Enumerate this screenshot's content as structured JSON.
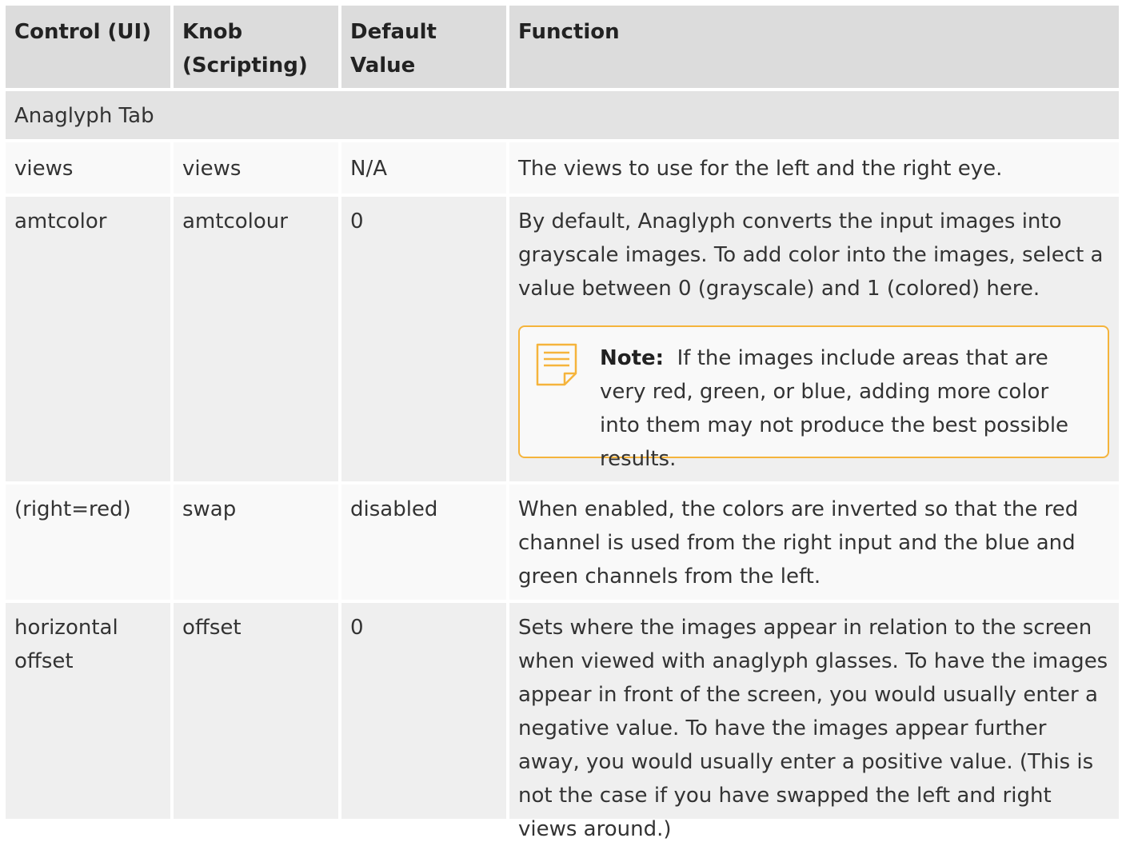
{
  "headers": {
    "control": "Control (UI)",
    "knob": "Knob (Scripting)",
    "default": "Default Value",
    "function": "Function"
  },
  "section_title": "Anaglyph Tab",
  "rows": [
    {
      "control": "views",
      "knob": "views",
      "default": "N/A",
      "function": "The views to use for the left and the right eye."
    },
    {
      "control": "amtcolor",
      "knob": "amtcolour",
      "default": "0",
      "function": "By default, Anaglyph converts the input images into grayscale images. To add color into the images, select a value between 0 (grayscale) and 1 (colored) here.",
      "note_label": "Note:",
      "note_text": "If the images include areas that are very red, green, or blue, adding more color into them may not produce the best possible results."
    },
    {
      "control": "(right=red)",
      "knob": "swap",
      "default": "disabled",
      "function": "When enabled, the colors are inverted so that the red channel is used from the right input and the blue and green channels from the left."
    },
    {
      "control": "horizontal offset",
      "knob": "offset",
      "default": "0",
      "function": "Sets where the images appear in relation to the screen when viewed with anaglyph glasses. To have the images appear in front of the screen, you would usually enter a negative value. To have the images appear further away, you would usually enter a positive value. (This is not the case if you have swapped the left and right views around.)"
    }
  ],
  "colors": {
    "header_bg": "#dcdcdc",
    "section_bg": "#e3e3e3",
    "note_border": "#f5b43c"
  },
  "icons": {
    "note": "note-icon"
  }
}
